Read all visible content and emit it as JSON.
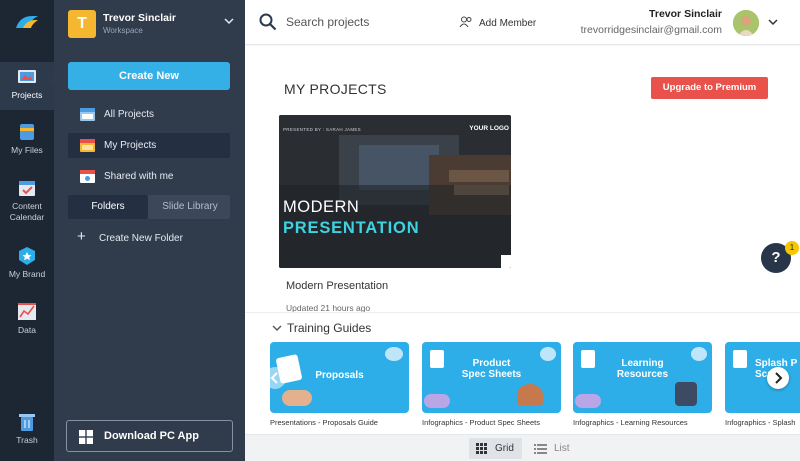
{
  "rail": {
    "items": [
      {
        "label": "Projects",
        "icon": "projects-icon",
        "active": true
      },
      {
        "label": "My Files",
        "icon": "files-icon"
      },
      {
        "label": "Content Calendar",
        "icon": "calendar-icon"
      },
      {
        "label": "My Brand",
        "icon": "brand-icon"
      },
      {
        "label": "Data",
        "icon": "data-icon"
      },
      {
        "label": "Trash",
        "icon": "trash-icon"
      }
    ]
  },
  "workspace": {
    "initial": "T",
    "name": "Trevor Sinclair",
    "subtitle": "Workspace"
  },
  "panel": {
    "create_new": "Create New",
    "nav": [
      {
        "label": "All Projects",
        "icon": "all-projects-icon"
      },
      {
        "label": "My Projects",
        "icon": "my-projects-icon",
        "selected": true
      },
      {
        "label": "Shared with me",
        "icon": "shared-icon"
      }
    ],
    "segments": [
      "Folders",
      "Slide Library"
    ],
    "new_folder": "Create New Folder",
    "download": "Download PC App"
  },
  "topbar": {
    "search_placeholder": "Search projects",
    "add_member": "Add Member",
    "user_name": "Trevor Sinclair",
    "user_email": "trevorridgesinclair@gmail.com"
  },
  "main": {
    "title": "MY PROJECTS",
    "upgrade": "Upgrade to Premium",
    "project": {
      "thumb_line1": "MODERN",
      "thumb_line2": "PRESENTATION",
      "thumb_small": "PRESENTED BY : SARAH JAMES",
      "thumb_logo": "YOUR LOGO",
      "title": "Modern Presentation",
      "updated": "Updated 21 hours ago"
    },
    "help": "?",
    "help_badge": "1"
  },
  "training": {
    "heading": "Training Guides",
    "guides": [
      {
        "title": "Proposals",
        "caption": "Presentations - Proposals Guide"
      },
      {
        "title": "Product\nSpec Sheets",
        "caption": "Infographics - Product Spec Sheets"
      },
      {
        "title": "Learning\nResources",
        "caption": "Infographics - Learning Resources"
      },
      {
        "title": "Splash P\nScrn",
        "caption": "Infographics - Splash"
      }
    ]
  },
  "view": {
    "grid": "Grid",
    "list": "List"
  },
  "colors": {
    "accent": "#35b0e6",
    "upgrade": "#e8524b",
    "rail_bg": "#1d2633",
    "panel_bg": "#303b4b"
  }
}
